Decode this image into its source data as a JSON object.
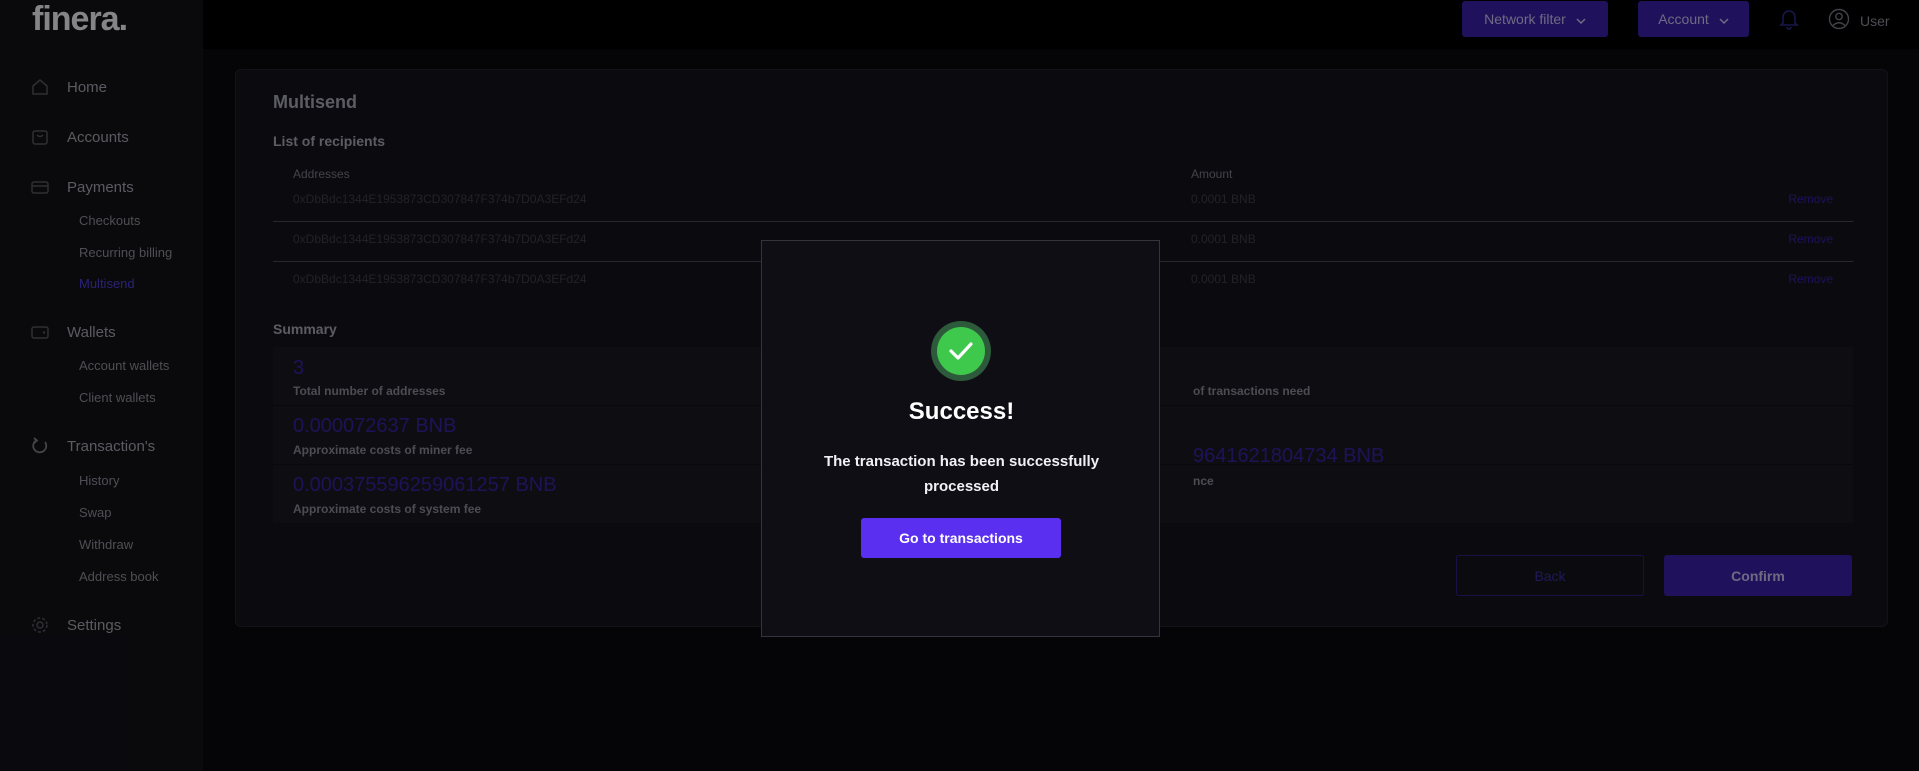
{
  "app": {
    "logo": "finera."
  },
  "header": {
    "network_filter_label": "Network filter",
    "account_label": "Account",
    "user_label": "User"
  },
  "sidebar": {
    "items": [
      {
        "label": "Home",
        "icon": "home-icon"
      },
      {
        "label": "Accounts",
        "icon": "bag-icon"
      },
      {
        "label": "Payments",
        "icon": "card-icon"
      },
      {
        "label": "Wallets",
        "icon": "wallet-icon"
      },
      {
        "label": "Transaction's",
        "icon": "refresh-icon"
      },
      {
        "label": "Settings",
        "icon": "gear-icon"
      }
    ],
    "payments_sub": [
      "Checkouts",
      "Recurring billing",
      "Multisend"
    ],
    "wallets_sub": [
      "Account wallets",
      "Client wallets"
    ],
    "transactions_sub": [
      "History",
      "Swap",
      "Withdraw",
      "Address book"
    ],
    "active_sub": "Multisend"
  },
  "multisend": {
    "title": "Multisend",
    "recipients_title": "List of recipients",
    "col_addresses": "Addresses",
    "col_amount": "Amount",
    "remove_label": "Remove",
    "rows": [
      {
        "address": "0xDbBdc1344E1953873CD307847F374b7D0A3EFd24",
        "amount": "0.0001 BNB"
      },
      {
        "address": "0xDbBdc1344E1953873CD307847F374b7D0A3EFd24",
        "amount": "0.0001 BNB"
      },
      {
        "address": "0xDbBdc1344E1953873CD307847F374b7D0A3EFd24",
        "amount": "0.0001 BNB"
      }
    ],
    "summary_title": "Summary",
    "summary": {
      "total_addresses_value": "3",
      "total_addresses_label": "Total number of addresses",
      "transactions_need_label": "of transactions need",
      "miner_fee_value": "0.000072637 BNB",
      "miner_fee_label": "Approximate costs of miner fee",
      "balance_value": "9641621804734 BNB",
      "balance_label": "nce",
      "system_fee_value": "0.000375596259061257 BNB",
      "system_fee_label": "Approximate costs of system fee"
    },
    "back_label": "Back",
    "confirm_label": "Confirm"
  },
  "modal": {
    "title": "Success!",
    "message": "The transaction has been successfully processed",
    "button_label": "Go to transactions"
  },
  "colors": {
    "accent": "#3a1fa6",
    "modal_button": "#5a2ff0",
    "success": "#3ec94c"
  }
}
